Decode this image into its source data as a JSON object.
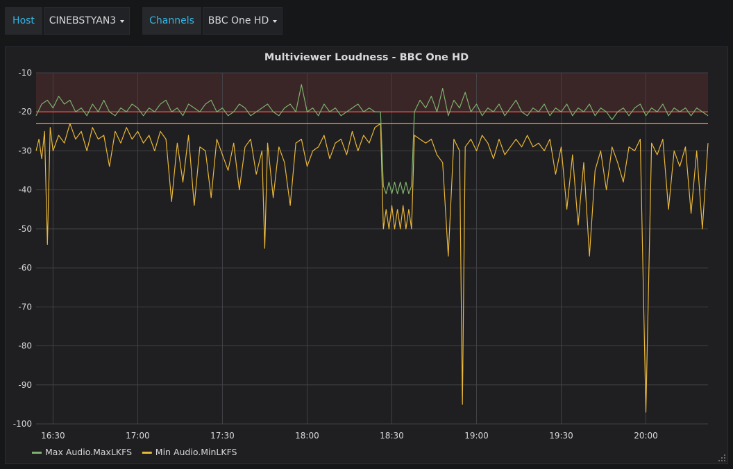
{
  "template_vars": [
    {
      "label": "Host",
      "value": "CINEBSTYAN3"
    },
    {
      "label": "Channels",
      "value": "BBC One HD"
    }
  ],
  "panel": {
    "title": "Multiviewer Loudness - BBC One HD"
  },
  "colors": {
    "max": "#7eb26d",
    "min": "#eab839",
    "threshold_line": "#e24d42",
    "threshold_fill": "#3a2527",
    "target_line": "#ef843c",
    "grid": "#424347",
    "text": "#d8d9da"
  },
  "chart_data": {
    "type": "line",
    "title": "Multiviewer Loudness - BBC One HD",
    "ylim": [
      -100,
      -10
    ],
    "yticks": [
      -10,
      -20,
      -30,
      -40,
      -50,
      -60,
      -70,
      -80,
      -90,
      -100
    ],
    "x_range": [
      "16:24",
      "18:24"
    ],
    "xticks": [
      "16:30",
      "17:00",
      "17:30",
      "18:00",
      "18:30",
      "19:00",
      "19:30",
      "20:00"
    ],
    "x_range_end": "20:22",
    "grid": true,
    "legend_position": "bottom-left",
    "thresholds": [
      {
        "value": -20,
        "fill_above": true,
        "color": "red"
      },
      {
        "value": -23,
        "color": "orange"
      }
    ],
    "series": [
      {
        "name": "Max Audio.MaxLKFS",
        "color": "#7eb26d",
        "points": [
          [
            "16:24",
            -21
          ],
          [
            "16:26",
            -18
          ],
          [
            "16:28",
            -17
          ],
          [
            "16:30",
            -19
          ],
          [
            "16:32",
            -16
          ],
          [
            "16:34",
            -18
          ],
          [
            "16:36",
            -17
          ],
          [
            "16:38",
            -20
          ],
          [
            "16:40",
            -19
          ],
          [
            "16:42",
            -21
          ],
          [
            "16:44",
            -18
          ],
          [
            "16:46",
            -20
          ],
          [
            "16:48",
            -17
          ],
          [
            "16:50",
            -20
          ],
          [
            "16:52",
            -21
          ],
          [
            "16:54",
            -19
          ],
          [
            "16:56",
            -20
          ],
          [
            "16:58",
            -18
          ],
          [
            "17:00",
            -19
          ],
          [
            "17:02",
            -21
          ],
          [
            "17:04",
            -19
          ],
          [
            "17:06",
            -20
          ],
          [
            "17:08",
            -18
          ],
          [
            "17:10",
            -17
          ],
          [
            "17:12",
            -20
          ],
          [
            "17:14",
            -19
          ],
          [
            "17:16",
            -21
          ],
          [
            "17:18",
            -18
          ],
          [
            "17:20",
            -19
          ],
          [
            "17:22",
            -20
          ],
          [
            "17:24",
            -18
          ],
          [
            "17:26",
            -17
          ],
          [
            "17:28",
            -20
          ],
          [
            "17:30",
            -19
          ],
          [
            "17:32",
            -21
          ],
          [
            "17:34",
            -20
          ],
          [
            "17:36",
            -18
          ],
          [
            "17:38",
            -19
          ],
          [
            "17:40",
            -21
          ],
          [
            "17:42",
            -20
          ],
          [
            "17:44",
            -19
          ],
          [
            "17:46",
            -18
          ],
          [
            "17:48",
            -20
          ],
          [
            "17:50",
            -21
          ],
          [
            "17:52",
            -19
          ],
          [
            "17:54",
            -18
          ],
          [
            "17:56",
            -20
          ],
          [
            "17:58",
            -13
          ],
          [
            "18:00",
            -20
          ],
          [
            "18:02",
            -19
          ],
          [
            "18:04",
            -21
          ],
          [
            "18:06",
            -18
          ],
          [
            "18:08",
            -20
          ],
          [
            "18:10",
            -19
          ],
          [
            "18:12",
            -21
          ],
          [
            "18:14",
            -20
          ],
          [
            "18:16",
            -19
          ],
          [
            "18:18",
            -18
          ],
          [
            "18:20",
            -20
          ],
          [
            "18:22",
            -19
          ],
          [
            "18:24",
            -20
          ],
          [
            "18:26",
            -20
          ],
          [
            "18:27",
            -39
          ],
          [
            "18:28",
            -41
          ],
          [
            "18:29",
            -38
          ],
          [
            "18:30",
            -41
          ],
          [
            "18:31",
            -38
          ],
          [
            "18:32",
            -41
          ],
          [
            "18:33",
            -38
          ],
          [
            "18:34",
            -41
          ],
          [
            "18:35",
            -38
          ],
          [
            "18:36",
            -41
          ],
          [
            "18:37",
            -39
          ],
          [
            "18:38",
            -20
          ],
          [
            "18:40",
            -17
          ],
          [
            "18:42",
            -19
          ],
          [
            "18:44",
            -16
          ],
          [
            "18:46",
            -20
          ],
          [
            "18:48",
            -14
          ],
          [
            "18:50",
            -21
          ],
          [
            "18:52",
            -17
          ],
          [
            "18:54",
            -19
          ],
          [
            "18:56",
            -15
          ],
          [
            "18:58",
            -20
          ],
          [
            "19:00",
            -18
          ],
          [
            "19:02",
            -21
          ],
          [
            "19:04",
            -19
          ],
          [
            "19:06",
            -20
          ],
          [
            "19:08",
            -18
          ],
          [
            "19:10",
            -21
          ],
          [
            "19:12",
            -19
          ],
          [
            "19:14",
            -17
          ],
          [
            "19:16",
            -20
          ],
          [
            "19:18",
            -21
          ],
          [
            "19:20",
            -19
          ],
          [
            "19:22",
            -20
          ],
          [
            "19:24",
            -18
          ],
          [
            "19:26",
            -21
          ],
          [
            "19:28",
            -19
          ],
          [
            "19:30",
            -20
          ],
          [
            "19:32",
            -18
          ],
          [
            "19:34",
            -21
          ],
          [
            "19:36",
            -19
          ],
          [
            "19:38",
            -20
          ],
          [
            "19:40",
            -18
          ],
          [
            "19:42",
            -21
          ],
          [
            "19:44",
            -19
          ],
          [
            "19:46",
            -20
          ],
          [
            "19:48",
            -22
          ],
          [
            "19:50",
            -20
          ],
          [
            "19:52",
            -19
          ],
          [
            "19:54",
            -21
          ],
          [
            "19:56",
            -19
          ],
          [
            "19:58",
            -18
          ],
          [
            "20:00",
            -21
          ],
          [
            "20:02",
            -19
          ],
          [
            "20:04",
            -20
          ],
          [
            "20:06",
            -18
          ],
          [
            "20:08",
            -21
          ],
          [
            "20:10",
            -19
          ],
          [
            "20:12",
            -20
          ],
          [
            "20:14",
            -19
          ],
          [
            "20:16",
            -21
          ],
          [
            "20:18",
            -19
          ],
          [
            "20:20",
            -20
          ],
          [
            "20:22",
            -21
          ]
        ]
      },
      {
        "name": "Min Audio.MinLKFS",
        "color": "#eab839",
        "points": [
          [
            "16:24",
            -30
          ],
          [
            "16:25",
            -27
          ],
          [
            "16:26",
            -32
          ],
          [
            "16:27",
            -25
          ],
          [
            "16:28",
            -54
          ],
          [
            "16:29",
            -24
          ],
          [
            "16:30",
            -30
          ],
          [
            "16:32",
            -26
          ],
          [
            "16:34",
            -28
          ],
          [
            "16:36",
            -23
          ],
          [
            "16:38",
            -27
          ],
          [
            "16:40",
            -25
          ],
          [
            "16:42",
            -30
          ],
          [
            "16:44",
            -24
          ],
          [
            "16:46",
            -27
          ],
          [
            "16:48",
            -26
          ],
          [
            "16:50",
            -34
          ],
          [
            "16:52",
            -25
          ],
          [
            "16:54",
            -28
          ],
          [
            "16:56",
            -24
          ],
          [
            "16:58",
            -27
          ],
          [
            "17:00",
            -25
          ],
          [
            "17:02",
            -28
          ],
          [
            "17:04",
            -26
          ],
          [
            "17:06",
            -30
          ],
          [
            "17:08",
            -25
          ],
          [
            "17:10",
            -27
          ],
          [
            "17:12",
            -43
          ],
          [
            "17:14",
            -28
          ],
          [
            "17:16",
            -38
          ],
          [
            "17:18",
            -26
          ],
          [
            "17:20",
            -44
          ],
          [
            "17:22",
            -29
          ],
          [
            "17:24",
            -30
          ],
          [
            "17:26",
            -42
          ],
          [
            "17:28",
            -27
          ],
          [
            "17:30",
            -31
          ],
          [
            "17:32",
            -35
          ],
          [
            "17:34",
            -28
          ],
          [
            "17:36",
            -40
          ],
          [
            "17:38",
            -29
          ],
          [
            "17:40",
            -27
          ],
          [
            "17:42",
            -36
          ],
          [
            "17:44",
            -30
          ],
          [
            "17:45",
            -55
          ],
          [
            "17:46",
            -28
          ],
          [
            "17:48",
            -42
          ],
          [
            "17:50",
            -29
          ],
          [
            "17:52",
            -33
          ],
          [
            "17:54",
            -44
          ],
          [
            "17:56",
            -28
          ],
          [
            "17:58",
            -27
          ],
          [
            "18:00",
            -34
          ],
          [
            "18:02",
            -30
          ],
          [
            "18:04",
            -29
          ],
          [
            "18:06",
            -26
          ],
          [
            "18:08",
            -32
          ],
          [
            "18:10",
            -28
          ],
          [
            "18:12",
            -27
          ],
          [
            "18:14",
            -31
          ],
          [
            "18:16",
            -25
          ],
          [
            "18:18",
            -30
          ],
          [
            "18:20",
            -26
          ],
          [
            "18:22",
            -28
          ],
          [
            "18:24",
            -24
          ],
          [
            "18:26",
            -23
          ],
          [
            "18:27",
            -50
          ],
          [
            "18:28",
            -45
          ],
          [
            "18:29",
            -50
          ],
          [
            "18:30",
            -44
          ],
          [
            "18:31",
            -50
          ],
          [
            "18:32",
            -45
          ],
          [
            "18:33",
            -50
          ],
          [
            "18:34",
            -44
          ],
          [
            "18:35",
            -50
          ],
          [
            "18:36",
            -45
          ],
          [
            "18:37",
            -50
          ],
          [
            "18:38",
            -26
          ],
          [
            "18:40",
            -27
          ],
          [
            "18:42",
            -28
          ],
          [
            "18:44",
            -27
          ],
          [
            "18:46",
            -31
          ],
          [
            "18:48",
            -33
          ],
          [
            "18:50",
            -57
          ],
          [
            "18:52",
            -27
          ],
          [
            "18:54",
            -30
          ],
          [
            "18:55",
            -95
          ],
          [
            "18:56",
            -29
          ],
          [
            "18:58",
            -27
          ],
          [
            "19:00",
            -30
          ],
          [
            "19:02",
            -26
          ],
          [
            "19:04",
            -28
          ],
          [
            "19:06",
            -32
          ],
          [
            "19:08",
            -27
          ],
          [
            "19:10",
            -31
          ],
          [
            "19:12",
            -29
          ],
          [
            "19:14",
            -27
          ],
          [
            "19:16",
            -29
          ],
          [
            "19:18",
            -26
          ],
          [
            "19:20",
            -29
          ],
          [
            "19:22",
            -28
          ],
          [
            "19:24",
            -30
          ],
          [
            "19:26",
            -27
          ],
          [
            "19:28",
            -36
          ],
          [
            "19:30",
            -29
          ],
          [
            "19:32",
            -45
          ],
          [
            "19:34",
            -31
          ],
          [
            "19:36",
            -49
          ],
          [
            "19:38",
            -33
          ],
          [
            "19:40",
            -57
          ],
          [
            "19:42",
            -35
          ],
          [
            "19:44",
            -30
          ],
          [
            "19:46",
            -40
          ],
          [
            "19:48",
            -29
          ],
          [
            "19:50",
            -33
          ],
          [
            "19:52",
            -38
          ],
          [
            "19:54",
            -29
          ],
          [
            "19:56",
            -30
          ],
          [
            "19:58",
            -27
          ],
          [
            "20:00",
            -97
          ],
          [
            "20:02",
            -28
          ],
          [
            "20:04",
            -31
          ],
          [
            "20:06",
            -27
          ],
          [
            "20:08",
            -45
          ],
          [
            "20:10",
            -30
          ],
          [
            "20:12",
            -34
          ],
          [
            "20:14",
            -29
          ],
          [
            "20:16",
            -46
          ],
          [
            "20:18",
            -30
          ],
          [
            "20:20",
            -50
          ],
          [
            "20:22",
            -28
          ]
        ]
      }
    ]
  }
}
